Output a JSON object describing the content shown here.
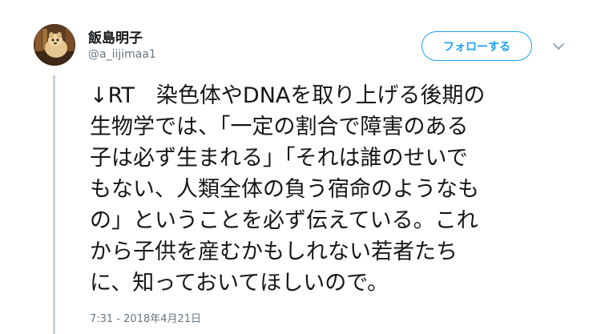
{
  "user": {
    "display_name": "飯島明子",
    "handle": "@a_iijimaa1"
  },
  "header": {
    "follow_label": "フォローする",
    "caret_icon": "chevron-down-icon"
  },
  "tweet": {
    "lines": [
      "↓RT　染色体やDNAを取り上げる後期の",
      "生物学では、「一定の割合で障害のある",
      "子は必ず生まれる」「それは誰のせいで",
      "もない、人類全体の負う宿命のようなも",
      "の」ということを必ず伝えている。これ",
      "から子供を産むかもしれない若者たち",
      "に、知っておいてほしいので。"
    ],
    "timestamp": "7:31 - 2018年4月21日"
  },
  "colors": {
    "accent": "#1da1f2",
    "secondary_text": "#657786",
    "thread_line": "#c4d3de"
  }
}
